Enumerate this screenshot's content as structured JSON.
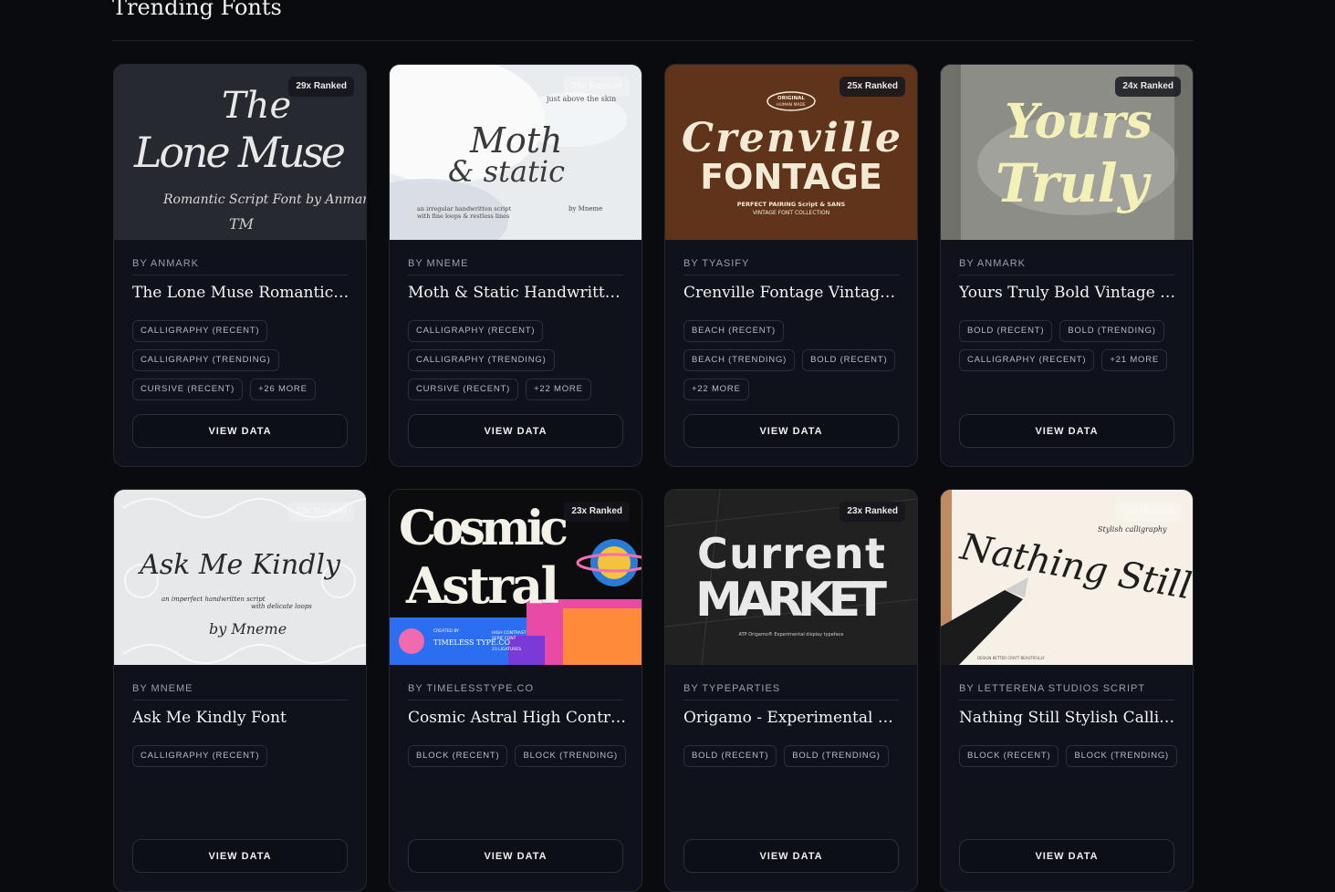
{
  "section": {
    "title": "Trending Fonts"
  },
  "cards": [
    {
      "rank": "29x Ranked",
      "author": "BY ANMARK",
      "name": "The Lone Muse Romantic Script Font",
      "tags": [
        "CALLIGRAPHY (RECENT)",
        "CALLIGRAPHY (TRENDING)",
        "CURSIVE (RECENT)",
        "+26 MORE"
      ],
      "button": "VIEW DATA",
      "thumb": {
        "bg": "#2b2e35",
        "line1": "The",
        "line2": "Lone Muse",
        "line3": "Romantic Script Font by Anmark",
        "line4": "TM",
        "ink": "#e8e8e8"
      }
    },
    {
      "rank": "25x Ranked",
      "author": "BY MNEME",
      "name": "Moth & Static Handwritten Script",
      "tags": [
        "CALLIGRAPHY (RECENT)",
        "CALLIGRAPHY (TRENDING)",
        "CURSIVE (RECENT)",
        "+22 MORE"
      ],
      "button": "VIEW DATA",
      "thumb": {
        "bg": "#e9ecef",
        "line0": "just above the skin",
        "line1": "Moth",
        "line2": "& static",
        "line3": "an irregular handwritten script",
        "line3b": "with fine loops & restless lines",
        "line4": "by Mneme",
        "ink": "#3a3a3a"
      }
    },
    {
      "rank": "25x Ranked",
      "author": "BY TYASIFY",
      "name": "Crenville Fontage Vintage Font",
      "tags": [
        "BEACH (RECENT)",
        "BEACH (TRENDING)",
        "BOLD (RECENT)",
        "+22 MORE"
      ],
      "button": "VIEW DATA",
      "thumb": {
        "bg": "#6a3a1e",
        "badge1": "ORIGINAL",
        "badge2": "HUMAN MADE",
        "line1": "Crenville",
        "line2": "FONTAGE",
        "line3": "PERFECT PAIRING Script & SANS",
        "line4": "VINTAGE FONT COLLECTION",
        "ink": "#f3ead6"
      }
    },
    {
      "rank": "24x Ranked",
      "author": "BY ANMARK",
      "name": "Yours Truly Bold Vintage Script",
      "tags": [
        "BOLD (RECENT)",
        "BOLD (TRENDING)",
        "CALLIGRAPHY (RECENT)",
        "+21 MORE"
      ],
      "button": "VIEW DATA",
      "thumb": {
        "bg": "#8d8d88",
        "line1": "Yours",
        "line2": "Truly",
        "ink": "#f3f0b8"
      }
    },
    {
      "rank": "23x Ranked",
      "author": "BY MNEME",
      "name": "Ask Me Kindly Font",
      "tags": [
        "CALLIGRAPHY (RECENT)"
      ],
      "button": "VIEW DATA",
      "thumb": {
        "bg": "#e6e8ea",
        "line1": "Ask Me Kindly",
        "line2": "an imperfect handwritten script",
        "line2b": "with delicate loops",
        "line3": "by Mneme",
        "ink": "#2a2a2a"
      }
    },
    {
      "rank": "23x Ranked",
      "author": "BY TIMELESSTYPE.CO",
      "name": "Cosmic Astral High Contrast Serif",
      "tags": [
        "BLOCK (RECENT)",
        "BLOCK (TRENDING)"
      ],
      "button": "VIEW DATA",
      "thumb": {
        "bg": "#0c0c0e",
        "line1": "Cosmic",
        "line2": "Astral",
        "line3": "CREATED BY",
        "line4": "TIMELESS TYPE.CO",
        "line5": "HIGH CONTRAST",
        "line6": "SERIF FONT",
        "line7": "23 LIGATURES",
        "ink": "#f4f1e8"
      }
    },
    {
      "rank": "23x Ranked",
      "author": "BY TYPEPARTIES",
      "name": "Origamo - Experimental Script",
      "tags": [
        "BOLD (RECENT)",
        "BOLD (TRENDING)"
      ],
      "button": "VIEW DATA",
      "thumb": {
        "bg": "#2a2a2a",
        "line1": "Current",
        "line2": "MARKET",
        "line3": "ATP Origamo® Experimental display typeface",
        "ink": "#e9e9e9"
      }
    },
    {
      "rank": "22x Ranked",
      "author": "BY LETTERENA STUDIOS SCRIPT",
      "name": "Nathing Still Stylish Calligraphy",
      "tags": [
        "BLOCK (RECENT)",
        "BLOCK (TRENDING)"
      ],
      "button": "VIEW DATA",
      "thumb": {
        "bg": "#f6f0e6",
        "line1": "Nathing Still",
        "line2": "Stylish calligraphy",
        "line3": "DESIGN BETTER CRAFT BEAUTIFULLY",
        "ink": "#1e1e1e"
      }
    }
  ]
}
